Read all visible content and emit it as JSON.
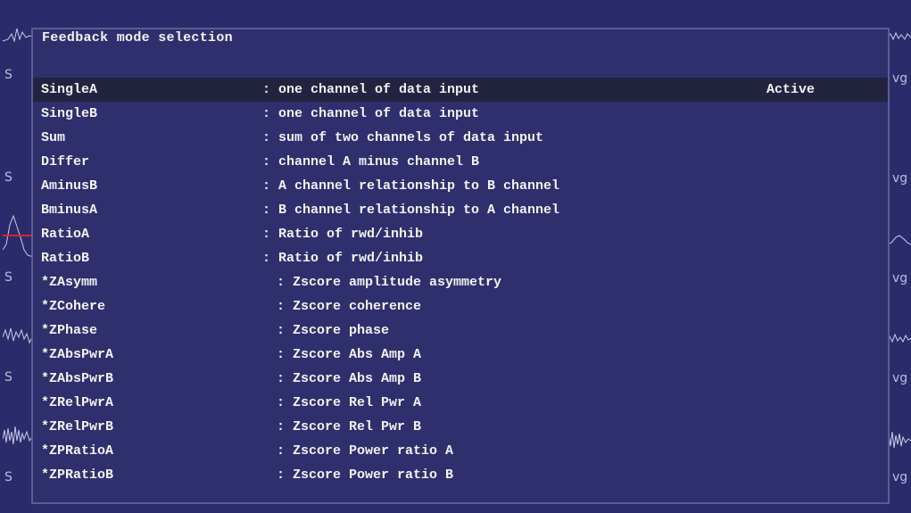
{
  "dialog": {
    "title": "Feedback mode selection",
    "modes": [
      {
        "name": "SingleA",
        "desc": ": one channel of data input",
        "status": "Active"
      },
      {
        "name": "SingleB",
        "desc": ": one channel of data input",
        "status": ""
      },
      {
        "name": "Sum",
        "desc": ": sum of two channels of data input",
        "status": ""
      },
      {
        "name": "Differ",
        "desc": ": channel A minus channel B",
        "status": ""
      },
      {
        "name": "AminusB",
        "desc": ": A channel relationship to B channel",
        "status": ""
      },
      {
        "name": "BminusA",
        "desc": ": B channel relationship to A channel",
        "status": ""
      },
      {
        "name": "RatioA",
        "desc": ": Ratio of rwd/inhib",
        "status": ""
      },
      {
        "name": "RatioB",
        "desc": ": Ratio of rwd/inhib",
        "status": ""
      },
      {
        "name": "*ZAsymm",
        "desc": ": Zscore amplitude asymmetry",
        "status": ""
      },
      {
        "name": "*ZCohere",
        "desc": ": Zscore coherence",
        "status": ""
      },
      {
        "name": "*ZPhase",
        "desc": ": Zscore phase",
        "status": ""
      },
      {
        "name": "*ZAbsPwrA",
        "desc": ": Zscore Abs Amp A",
        "status": ""
      },
      {
        "name": "*ZAbsPwrB",
        "desc": ": Zscore Abs Amp B",
        "status": ""
      },
      {
        "name": "*ZRelPwrA",
        "desc": ": Zscore Rel Pwr A",
        "status": ""
      },
      {
        "name": "*ZRelPwrB",
        "desc": ": Zscore Rel Pwr B",
        "status": ""
      },
      {
        "name": "*ZPRatioA",
        "desc": ": Zscore Power ratio A",
        "status": ""
      },
      {
        "name": "*ZPRatioB",
        "desc": ": Zscore Power ratio B",
        "status": ""
      }
    ]
  },
  "background": {
    "left_labels": [
      "S",
      "S",
      "S",
      "S",
      "S"
    ],
    "right_labels": [
      "vg",
      "vg",
      "vg",
      "vg",
      "vg"
    ]
  },
  "colors": {
    "background": "#2b2b6b",
    "dialog": "#2f2f6e",
    "selected_row": "#22243f",
    "text": "#f2f2f2",
    "marker": "#e0202a"
  }
}
